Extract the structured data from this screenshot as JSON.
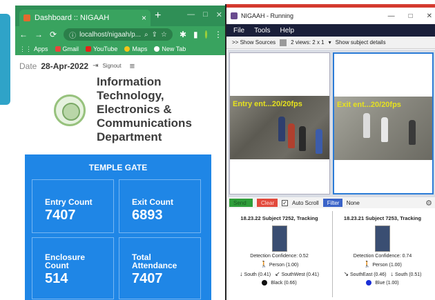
{
  "browser": {
    "tab_title": "Dashboard :: NIGAAH",
    "tab_close": "×",
    "new_tab": "+",
    "win_min": "—",
    "win_max": "□",
    "win_close": "✕",
    "url": "localhost/nigaah/p...",
    "bookmarks": [
      "Apps",
      "Gmail",
      "YouTube",
      "Maps",
      "New Tab"
    ]
  },
  "dashboard": {
    "date_label": "Date",
    "date_value": "28-Apr-2022",
    "signout": "Signout",
    "department": "Information Technology, Electronics & Communications Department",
    "gate_title": "TEMPLE GATE",
    "cards": {
      "entry": {
        "label": "Entry Count",
        "value": "7407"
      },
      "exit": {
        "label": "Exit Count",
        "value": "6893"
      },
      "enclosure": {
        "label": "Enclosure Count",
        "value": "514"
      },
      "total": {
        "label": "Total Attendance",
        "value": "7407"
      }
    }
  },
  "nigaah": {
    "title": "NIGAAH - Running",
    "menu": [
      "File",
      "Tools",
      "Help"
    ],
    "toolbar": {
      "show_sources": ">> Show Sources",
      "views": "2 views: 2 x 1",
      "show_details": "Show subject details"
    },
    "feeds": [
      {
        "caption": "Entry ent...20/20fps"
      },
      {
        "caption": "Exit ent...20/20fps"
      }
    ],
    "filterbar": {
      "send": "Send",
      "clear": "Clear",
      "auto_scroll": "Auto Scroll",
      "filter": "Filter",
      "filter_value": "None"
    },
    "panels": [
      {
        "header": "18.23.22  Subject 7252,  Tracking",
        "confidence": "Detection Confidence: 0.52",
        "person": "Person (1.00)",
        "dir_a": "South (0.41)",
        "dir_b": "SouthWest (0.41)",
        "color": "Black (0.66)",
        "color_hex": "#111111"
      },
      {
        "header": "18.23.21  Subject 7253,  Tracking",
        "confidence": "Detection Confidence: 0.74",
        "person": "Person (1.00)",
        "dir_a": "SouthEast (0.46)",
        "dir_b": "South (0.51)",
        "color": "Blue (1.00)",
        "color_hex": "#1a2fd6"
      }
    ]
  }
}
